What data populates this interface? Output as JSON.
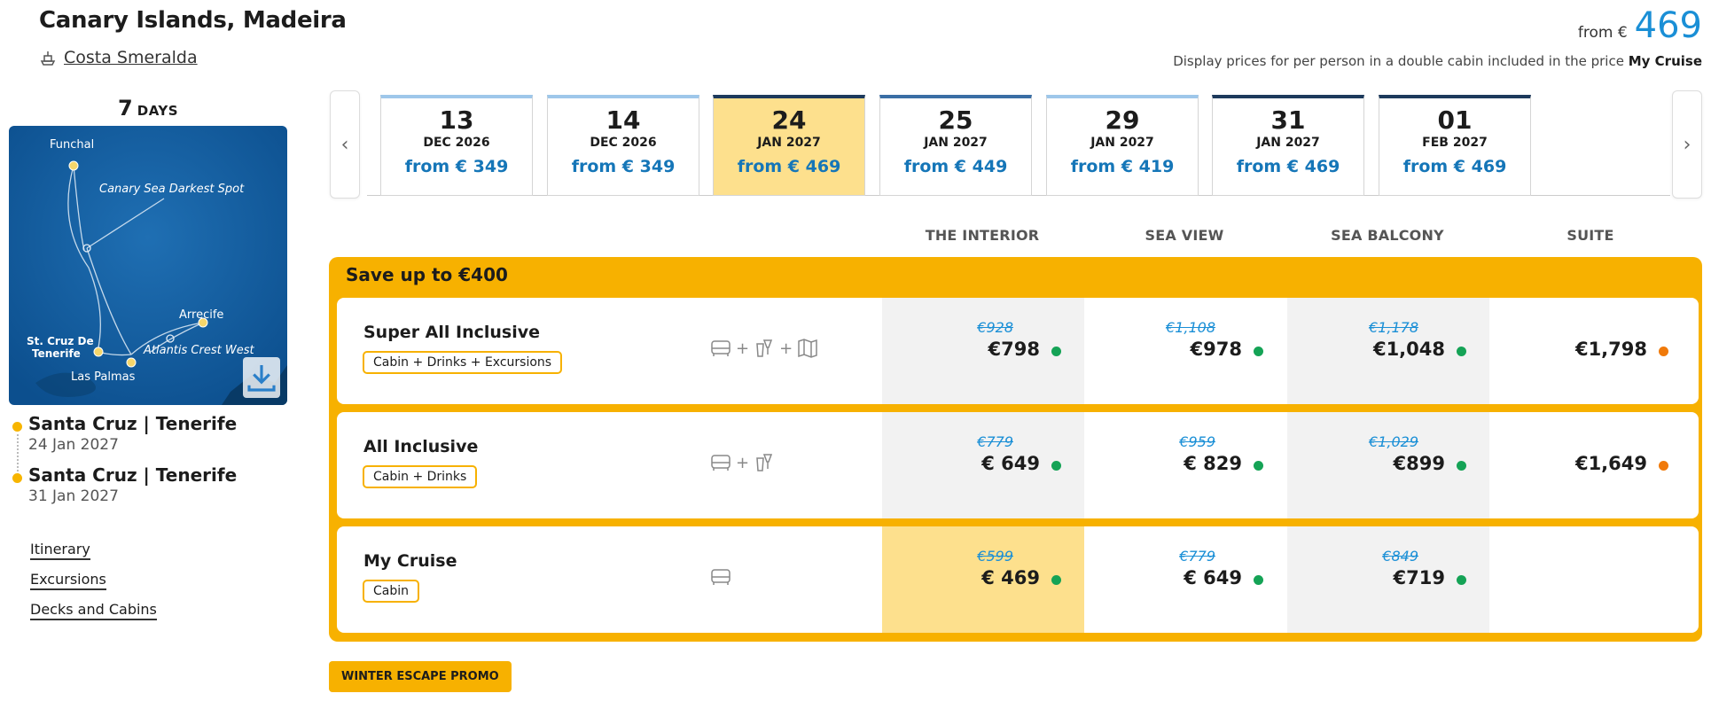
{
  "header": {
    "title": "Canary Islands, Madeira",
    "ship": "Costa Smeralda",
    "from_label": "from €",
    "from_price": "469",
    "note_prefix": "Display prices for per person in a double cabin included in the price",
    "note_bold": "My Cruise"
  },
  "duration": {
    "num": "7",
    "unit": "DAYS"
  },
  "map": {
    "labels": [
      "Funchal",
      "Canary Sea Darkest Spot",
      "Arrecife",
      "Atlantis Crest West",
      "St. Cruz De",
      "Tenerife",
      "Las Palmas"
    ]
  },
  "stops": [
    {
      "port": "Santa Cruz | Tenerife",
      "date": "24 Jan 2027"
    },
    {
      "port": "Santa Cruz | Tenerife",
      "date": "31 Jan 2027"
    }
  ],
  "links": [
    "Itinerary",
    "Excursions",
    "Decks and Cabins"
  ],
  "dates": [
    {
      "day": "13",
      "month": "DEC 2026",
      "price": "from € 349"
    },
    {
      "day": "14",
      "month": "DEC 2026",
      "price": "from € 349"
    },
    {
      "day": "24",
      "month": "JAN 2027",
      "price": "from € 469"
    },
    {
      "day": "25",
      "month": "JAN 2027",
      "price": "from € 449"
    },
    {
      "day": "29",
      "month": "JAN 2027",
      "price": "from € 419"
    },
    {
      "day": "31",
      "month": "JAN 2027",
      "price": "from € 469"
    },
    {
      "day": "01",
      "month": "FEB 2027",
      "price": "from € 469"
    }
  ],
  "columns": [
    "THE INTERIOR",
    "SEA VIEW",
    "SEA BALCONY",
    "SUITE"
  ],
  "save": "Save up to €400",
  "packages": [
    {
      "name": "Super All Inclusive",
      "tag": "Cabin + Drinks + Excursions",
      "prices": [
        {
          "old": "€928",
          "now": "€798",
          "status": "green"
        },
        {
          "old": "€1,108",
          "now": "€978",
          "status": "green"
        },
        {
          "old": "€1,178",
          "now": "€1,048",
          "status": "green"
        },
        {
          "old": "",
          "now": "€1,798",
          "status": "orange"
        }
      ]
    },
    {
      "name": "All Inclusive",
      "tag": "Cabin + Drinks",
      "prices": [
        {
          "old": "€779",
          "now": "€ 649",
          "status": "green"
        },
        {
          "old": "€959",
          "now": "€ 829",
          "status": "green"
        },
        {
          "old": "€1,029",
          "now": "€899",
          "status": "green"
        },
        {
          "old": "",
          "now": "€1,649",
          "status": "orange"
        }
      ]
    },
    {
      "name": "My Cruise",
      "tag": "Cabin",
      "prices": [
        {
          "old": "€599",
          "now": "€ 469",
          "status": "green"
        },
        {
          "old": "€779",
          "now": "€ 649",
          "status": "green"
        },
        {
          "old": "€849",
          "now": "€719",
          "status": "green"
        }
      ]
    }
  ],
  "promo": "WINTER ESCAPE PROMO"
}
